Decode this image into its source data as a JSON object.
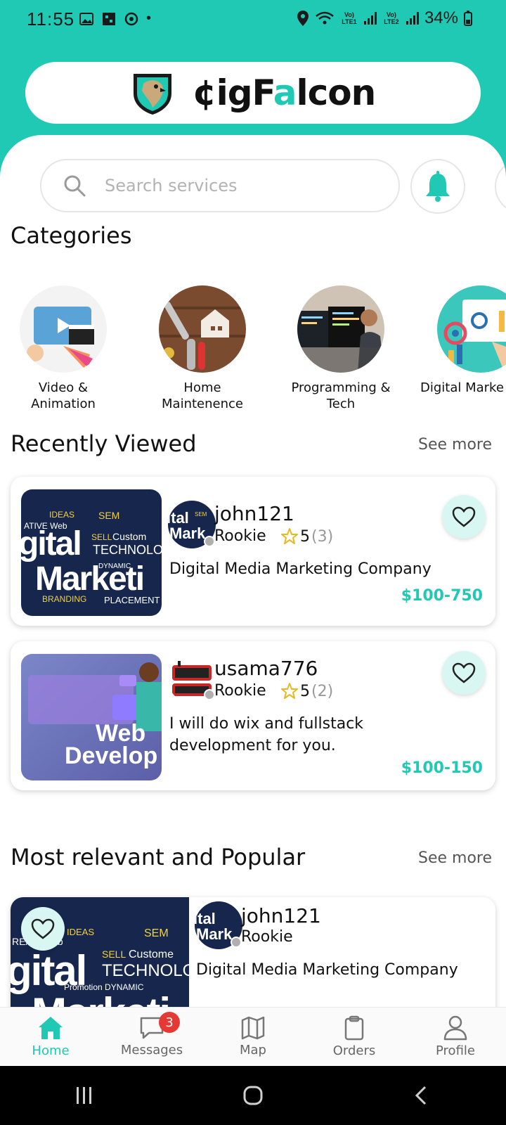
{
  "status_bar": {
    "time": "11:55",
    "dot": "•",
    "net1": "Vo) LTE1",
    "net2": "Vo) LTE2",
    "battery": "34%"
  },
  "header": {
    "logo_text_a": "¢igF",
    "logo_text_b": "a",
    "logo_text_c": "lcon"
  },
  "search": {
    "placeholder": "Search services"
  },
  "categories": {
    "title": "Categories",
    "items": [
      {
        "label_1": "Video &",
        "label_2": "Animation"
      },
      {
        "label_1": "Home",
        "label_2": "Maintenence"
      },
      {
        "label_1": "Programming &",
        "label_2": "Tech"
      },
      {
        "label_1": "Digital Marke",
        "label_2": ""
      }
    ]
  },
  "recently_viewed": {
    "title": "Recently Viewed",
    "see_more": "See more",
    "cards": [
      {
        "thumb_text_1": "gital",
        "thumb_text_2": "Marketi",
        "username": "john121",
        "level": "Rookie",
        "rating": "5",
        "count": "(3)",
        "title_1": "Digital Media Marketing Company",
        "title_2": "",
        "price": "$100-750"
      },
      {
        "thumb_text_1": "Web",
        "thumb_text_2": "Develop",
        "username": "usama776",
        "level": "Rookie",
        "rating": "5",
        "count": "(2)",
        "title_1": "I will do wix and fullstack",
        "title_2": "development for you.",
        "price": "$100-150"
      }
    ]
  },
  "popular": {
    "title": "Most relevant and Popular",
    "see_more": "See more",
    "card": {
      "thumb_text_1": "gital",
      "thumb_text_2": "Marketi",
      "username": "john121",
      "level": "Rookie",
      "title_1": "Digital Media Marketing Company",
      "title_2": ""
    }
  },
  "nav": {
    "items": [
      {
        "label": "Home"
      },
      {
        "label": "Messages",
        "badge": "3"
      },
      {
        "label": "Map"
      },
      {
        "label": "Orders"
      },
      {
        "label": "Profile"
      }
    ]
  },
  "colors": {
    "accent": "#1fc9b3",
    "badge": "#e53935",
    "star": "#e8b923"
  }
}
